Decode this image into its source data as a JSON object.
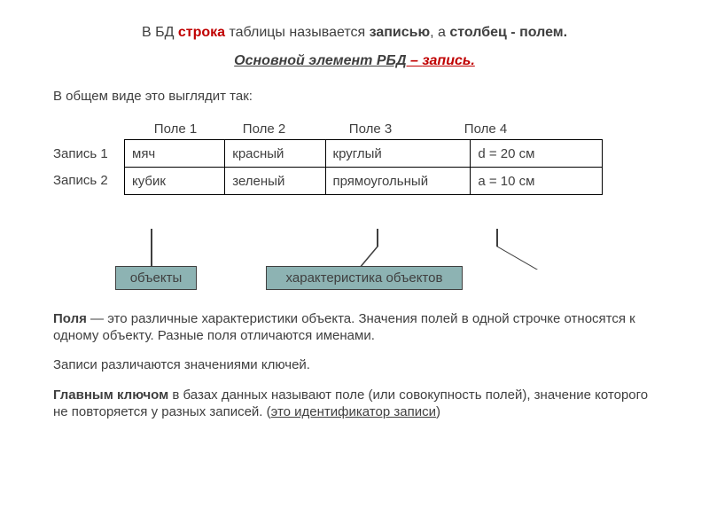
{
  "headline": {
    "p1": "В БД ",
    "p2": "строка",
    "p3": " таблицы называется ",
    "p4": "записью",
    "p5": ", а ",
    "p6": "столбец - полем."
  },
  "subtitle": {
    "lead": "Основной элемент РБД",
    "dash": " – ",
    "tail": "запись."
  },
  "intro": "В общем виде это выглядит так:",
  "fields": {
    "f1": "Поле 1",
    "f2": "Поле 2",
    "f3": "Поле 3",
    "f4": "Поле 4"
  },
  "rows": {
    "r1": "Запись 1",
    "r2": "Запись 2"
  },
  "table": {
    "row1": {
      "c1": "мяч",
      "c2": "красный",
      "c3": "круглый",
      "c4": "d = 20 см"
    },
    "row2": {
      "c1": "кубик",
      "c2": "зеленый",
      "c3": "прямоугольный",
      "c4": "a = 10 см"
    }
  },
  "badges": {
    "left": "объекты",
    "right": "характеристика объектов"
  },
  "body": {
    "p1a": "Поля",
    "p1b": " — это различные характеристики объекта. Значения полей в одной строчке относятся к одному объекту. Разные поля отличаются именами.",
    "p2": "Записи различаются значениями ключей.",
    "p3a": "Главным ключом",
    "p3b": " в базах данных называют поле (или совокупность полей), значение которого не повторяется у разных записей. (",
    "p3c": "это идентификатор записи",
    "p3d": ")"
  }
}
